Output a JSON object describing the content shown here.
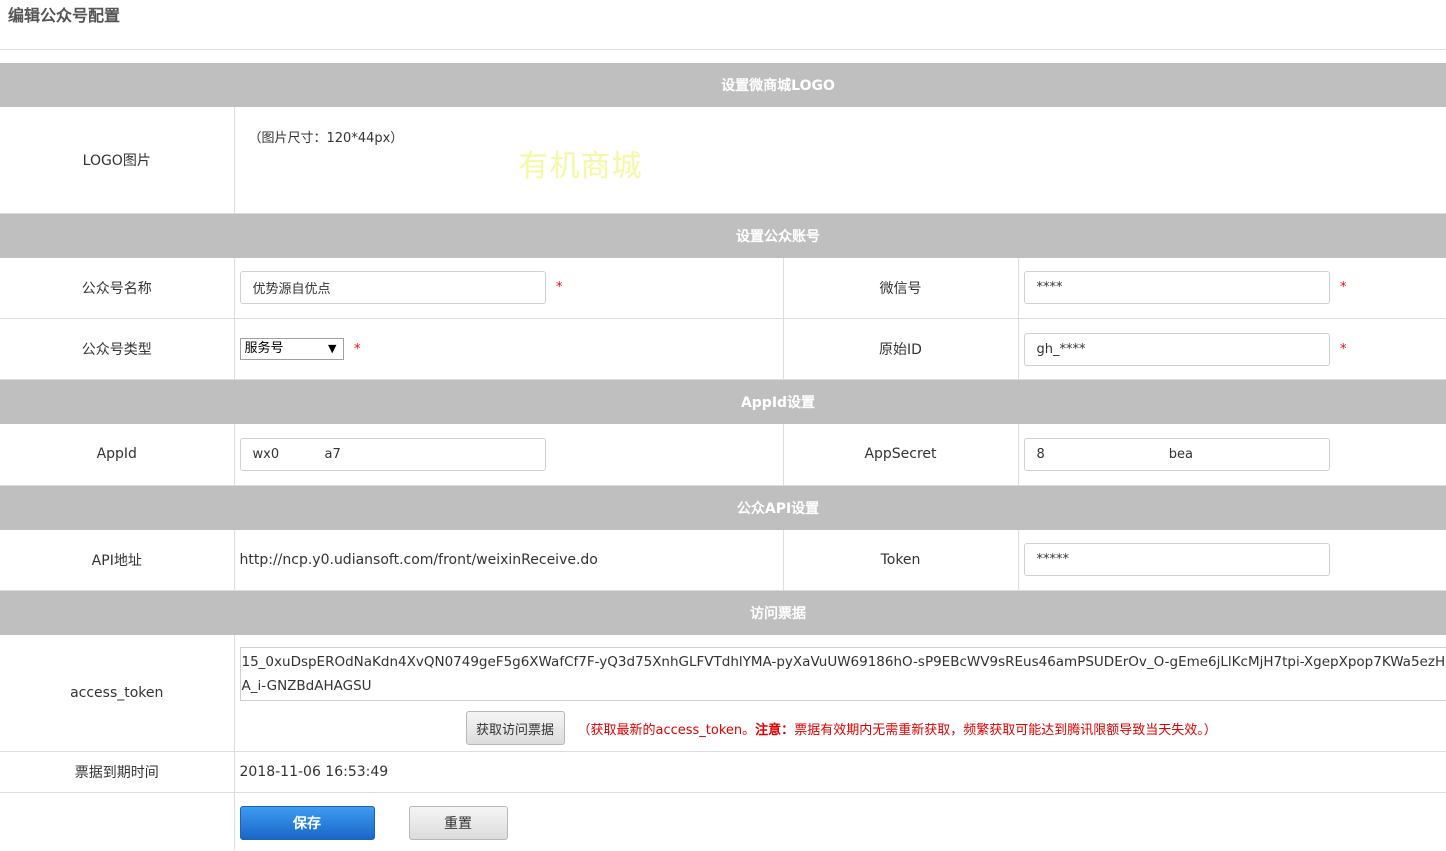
{
  "page": {
    "title": "编辑公众号配置"
  },
  "sections": {
    "logo": "设置微商城LOGO",
    "account": "设置公众账号",
    "appid": "AppId设置",
    "api": "公众API设置",
    "ticket": "访问票据"
  },
  "logo": {
    "label": "LOGO图片",
    "hint": "（图片尺寸：120*44px）",
    "image_text": "有机商城"
  },
  "account": {
    "name_label": "公众号名称",
    "name_value": "优势源自优点",
    "wechat_label": "微信号",
    "wechat_value": "****",
    "type_label": "公众号类型",
    "type_selected": "服务号",
    "original_id_label": "原始ID",
    "original_id_value": "gh_****",
    "required_mark": "*"
  },
  "appid": {
    "appid_label": "AppId",
    "appid_value": "wx0           a7",
    "secret_label": "AppSecret",
    "secret_value": "8                              bea"
  },
  "api": {
    "url_label": "API地址",
    "url_value": "http://ncp.y0.udiansoft.com/front/weixinReceive.do",
    "token_label": "Token",
    "token_value": "*****"
  },
  "ticket": {
    "access_token_label": "access_token",
    "access_token_value": "15_0xuDspEROdNaKdn4XvQN0749geF5g6XWafCf7F-yQ3d75XnhGLFVTdhlYMA-pyXaVuUW69186hO-sP9EBcWV9sREus46amPSUDErOv_O-gEme6jLlKcMjH7tpi-XgepXpop7KWa5ezHA_i-GNZBdAHAGSU",
    "fetch_button": "获取访问票据",
    "note_prefix": "（获取最新的access_token。",
    "note_bold": "注意：",
    "note_suffix": "票据有效期内无需重新获取，频繁获取可能达到腾讯限额导致当天失效。）",
    "expire_label": "票据到期时间",
    "expire_value": "2018-11-06 16:53:49"
  },
  "actions": {
    "save": "保存",
    "reset": "重置"
  },
  "colors": {
    "section_bg": "#bfbfbf",
    "primary_button": "#1a66c8",
    "required": "#ff0000",
    "note": "#e00000"
  }
}
